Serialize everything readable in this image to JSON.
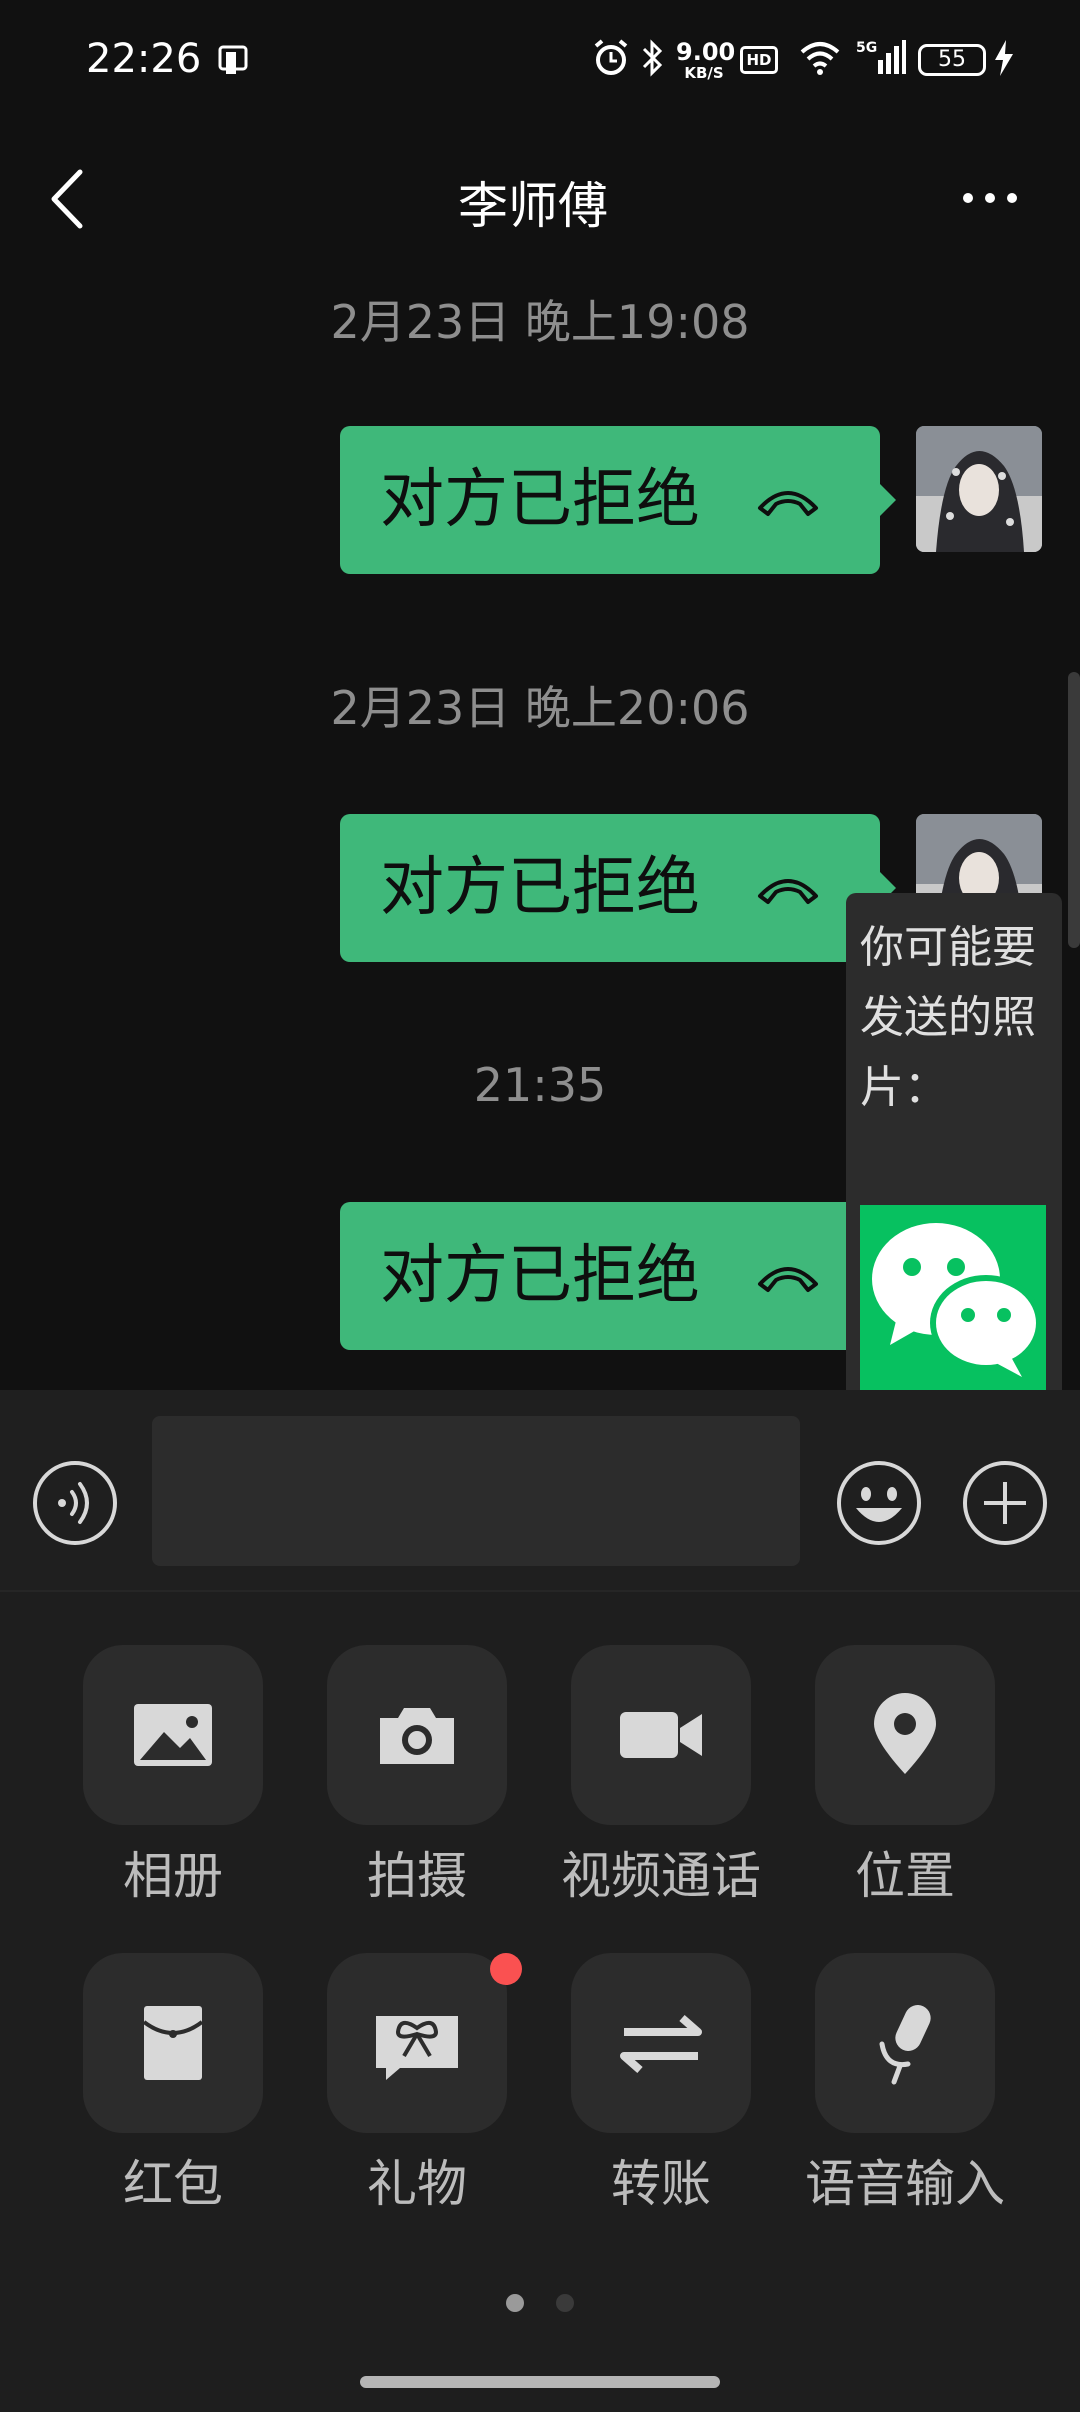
{
  "status_bar": {
    "time": "22:26",
    "net_speed_value": "9.00",
    "net_speed_unit": "KB/S",
    "hd_label": "HD",
    "signal_label": "5G",
    "battery": "55"
  },
  "header": {
    "title": "李师傅"
  },
  "messages": [
    {
      "timestamp": "2月23日 晚上19:08",
      "text": "对方已拒绝"
    },
    {
      "timestamp": "2月23日 晚上20:06",
      "text": "对方已拒绝"
    },
    {
      "timestamp": "21:35",
      "text": "对方已拒绝"
    }
  ],
  "photo_suggestion": {
    "text": "你可能要发送的照片："
  },
  "input": {
    "placeholder": ""
  },
  "panel": {
    "items": [
      {
        "label": "相册",
        "icon": "image-icon"
      },
      {
        "label": "拍摄",
        "icon": "camera-icon"
      },
      {
        "label": "视频通话",
        "icon": "video-icon"
      },
      {
        "label": "位置",
        "icon": "location-pin-icon"
      },
      {
        "label": "红包",
        "icon": "red-packet-icon"
      },
      {
        "label": "礼物",
        "icon": "gift-icon"
      },
      {
        "label": "转账",
        "icon": "transfer-icon"
      },
      {
        "label": "语音输入",
        "icon": "microphone-icon"
      }
    ],
    "page_count": 2,
    "current_page": 1
  },
  "colors": {
    "background": "#111111",
    "bubble": "#3fb87a",
    "wechat_green": "#07c160",
    "badge_red": "#fa5151"
  }
}
